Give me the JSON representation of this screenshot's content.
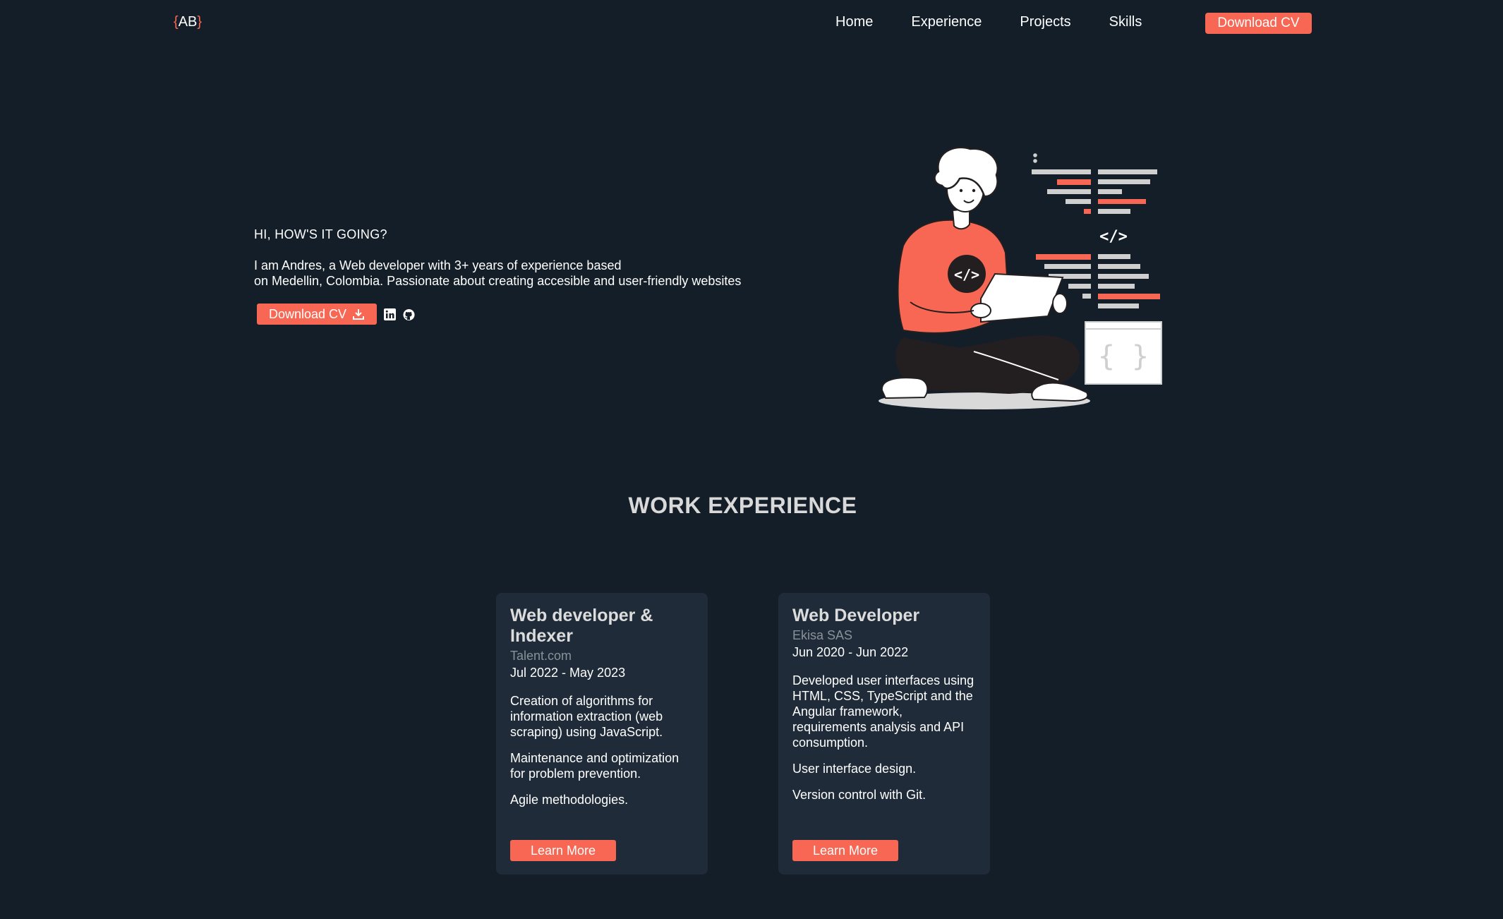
{
  "nav": {
    "logo": {
      "open": "{",
      "text": "AB",
      "close": "}"
    },
    "links": [
      "Home",
      "Experience",
      "Projects",
      "Skills"
    ],
    "cta": "Download CV"
  },
  "hero": {
    "greeting": "HI, HOW'S IT GOING?",
    "intro_line1": "I am Andres, a Web developer with 3+ years of experience based",
    "intro_line2": "on Medellin, Colombia. Passionate about creating accesible and user-friendly websites",
    "download_label": "Download CV",
    "download_icon": "download-icon",
    "socials": [
      "linkedin-icon",
      "github-icon"
    ],
    "illustration_code_tag": "</>",
    "illustration_braces": "{ }"
  },
  "experience": {
    "title": "WORK EXPERIENCE",
    "jobs": [
      {
        "title": "Web developer & Indexer",
        "company": "Talent.com",
        "dates": "Jul 2022 - May 2023",
        "bullets": [
          "Creation of algorithms for information extraction (web scraping) using JavaScript.",
          "Maintenance and optimization for problem prevention.",
          "Agile methodologies."
        ],
        "button": "Learn More"
      },
      {
        "title": "Web Developer",
        "company": "Ekisa SAS",
        "dates": "Jun 2020 - Jun 2022",
        "bullets": [
          "Developed user interfaces using HTML, CSS, TypeScript and the Angular framework, requirements analysis and API consumption.",
          "User interface design.",
          "Version control with Git."
        ],
        "button": "Learn More"
      }
    ]
  },
  "colors": {
    "background": "#141e28",
    "card": "#1f2b38",
    "accent": "#f86754"
  }
}
